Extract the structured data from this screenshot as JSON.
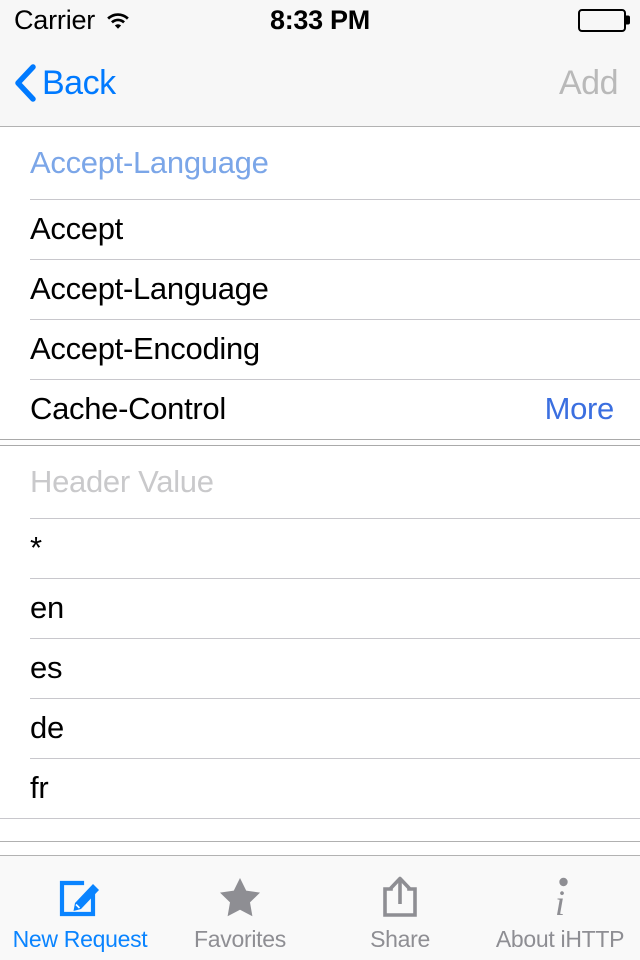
{
  "status_bar": {
    "carrier": "Carrier",
    "wifi_icon": "wifi-icon",
    "time": "8:33 PM",
    "battery_icon": "battery-icon"
  },
  "nav_bar": {
    "back_icon": "chevron-left-icon",
    "back_label": "Back",
    "add_label": "Add",
    "add_enabled": false
  },
  "header_name_field": {
    "value": "Accept-Language",
    "color": "#7ba6e8"
  },
  "header_name_suggestions": {
    "rows": [
      {
        "label": "Accept",
        "accessory": ""
      },
      {
        "label": "Accept-Language",
        "accessory": ""
      },
      {
        "label": "Accept-Encoding",
        "accessory": ""
      },
      {
        "label": "Cache-Control",
        "accessory": "More"
      }
    ]
  },
  "header_value_field": {
    "placeholder": "Header Value",
    "value": "",
    "color": "#c9c9cb"
  },
  "header_value_suggestions": {
    "rows": [
      {
        "label": "*"
      },
      {
        "label": "en"
      },
      {
        "label": "es"
      },
      {
        "label": "de"
      },
      {
        "label": "fr"
      }
    ]
  },
  "tab_bar": {
    "tabs": [
      {
        "label": "New Request",
        "icon": "compose-icon",
        "active": true
      },
      {
        "label": "Favorites",
        "icon": "star-icon",
        "active": false
      },
      {
        "label": "Share",
        "icon": "share-icon",
        "active": false
      },
      {
        "label": "About iHTTP",
        "icon": "info-icon",
        "active": false
      }
    ]
  },
  "colors": {
    "tint_blue": "#007aff",
    "link_blue": "#3b6fe0",
    "light_blue": "#7ba6e8",
    "disabled_gray": "#b9b9b9",
    "placeholder_gray": "#c9c9cb",
    "tab_inactive": "#8e8e93",
    "tab_active": "#0a84ff",
    "separator": "#c8c7cc",
    "bar_background": "#f7f7f7"
  }
}
